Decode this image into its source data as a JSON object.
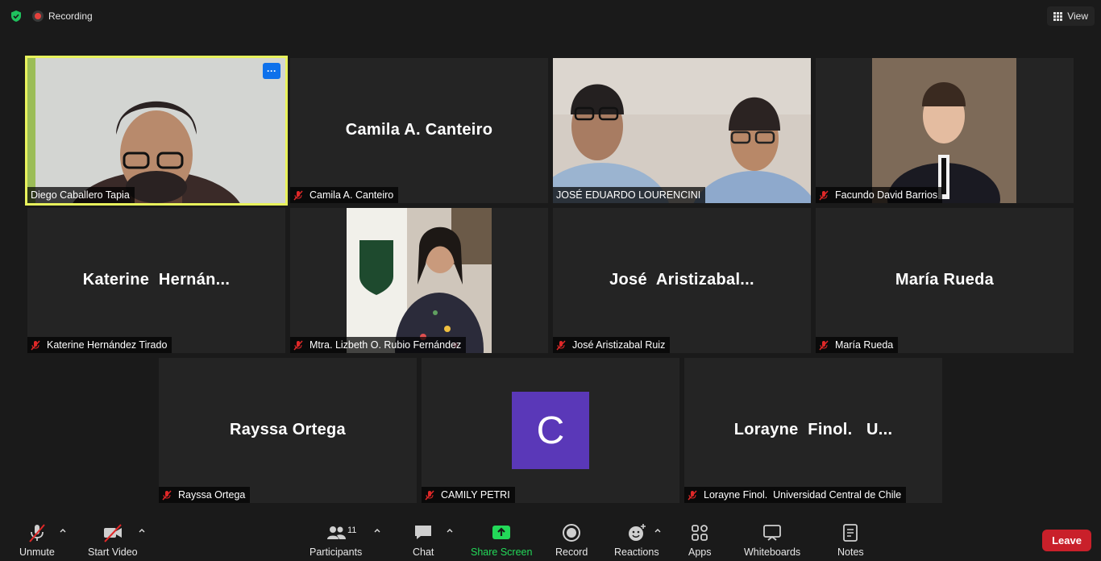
{
  "topbar": {
    "recording_label": "Recording",
    "view_label": "View"
  },
  "participants": [
    {
      "display_name": "",
      "label": "Diego Caballero Tapia",
      "muted": false,
      "video": true
    },
    {
      "display_name": "Camila A. Canteiro",
      "label": "Camila A. Canteiro",
      "muted": true,
      "video": false
    },
    {
      "display_name": "",
      "label": "JOSÉ EDUARDO LOURENCINI",
      "muted": false,
      "video": true
    },
    {
      "display_name": "",
      "label": "Facundo David Barrios",
      "muted": true,
      "video": true
    },
    {
      "display_name": "Katerine  Hernán...",
      "label": "Katerine Hernández Tirado",
      "muted": true,
      "video": false
    },
    {
      "display_name": "",
      "label": "Mtra. Lizbeth O. Rubio Fernández",
      "muted": true,
      "video": true
    },
    {
      "display_name": "José  Aristizabal...",
      "label": "José Aristizabal Ruiz",
      "muted": true,
      "video": false
    },
    {
      "display_name": "María Rueda",
      "label": "María Rueda",
      "muted": true,
      "video": false
    },
    {
      "display_name": "Rayssa Ortega",
      "label": "Rayssa Ortega",
      "muted": true,
      "video": false
    },
    {
      "display_name": "C",
      "label": "CAMILY PETRI",
      "muted": true,
      "video": false
    },
    {
      "display_name": "Lorayne  Finol.   U...",
      "label": "Lorayne Finol.  Universidad Central de Chile",
      "muted": true,
      "video": false
    }
  ],
  "toolbar": {
    "unmute": "Unmute",
    "start_video": "Start Video",
    "participants": "Participants",
    "participants_count": "11",
    "chat": "Chat",
    "share_screen": "Share Screen",
    "record": "Record",
    "reactions": "Reactions",
    "apps": "Apps",
    "whiteboards": "Whiteboards",
    "notes": "Notes",
    "leave": "Leave"
  },
  "colors": {
    "active_speaker": "#e8f25c",
    "share_green": "#23d959",
    "leave_red": "#c9202a",
    "avatar_purple": "#5a38b8",
    "more_blue": "#0e71eb"
  }
}
